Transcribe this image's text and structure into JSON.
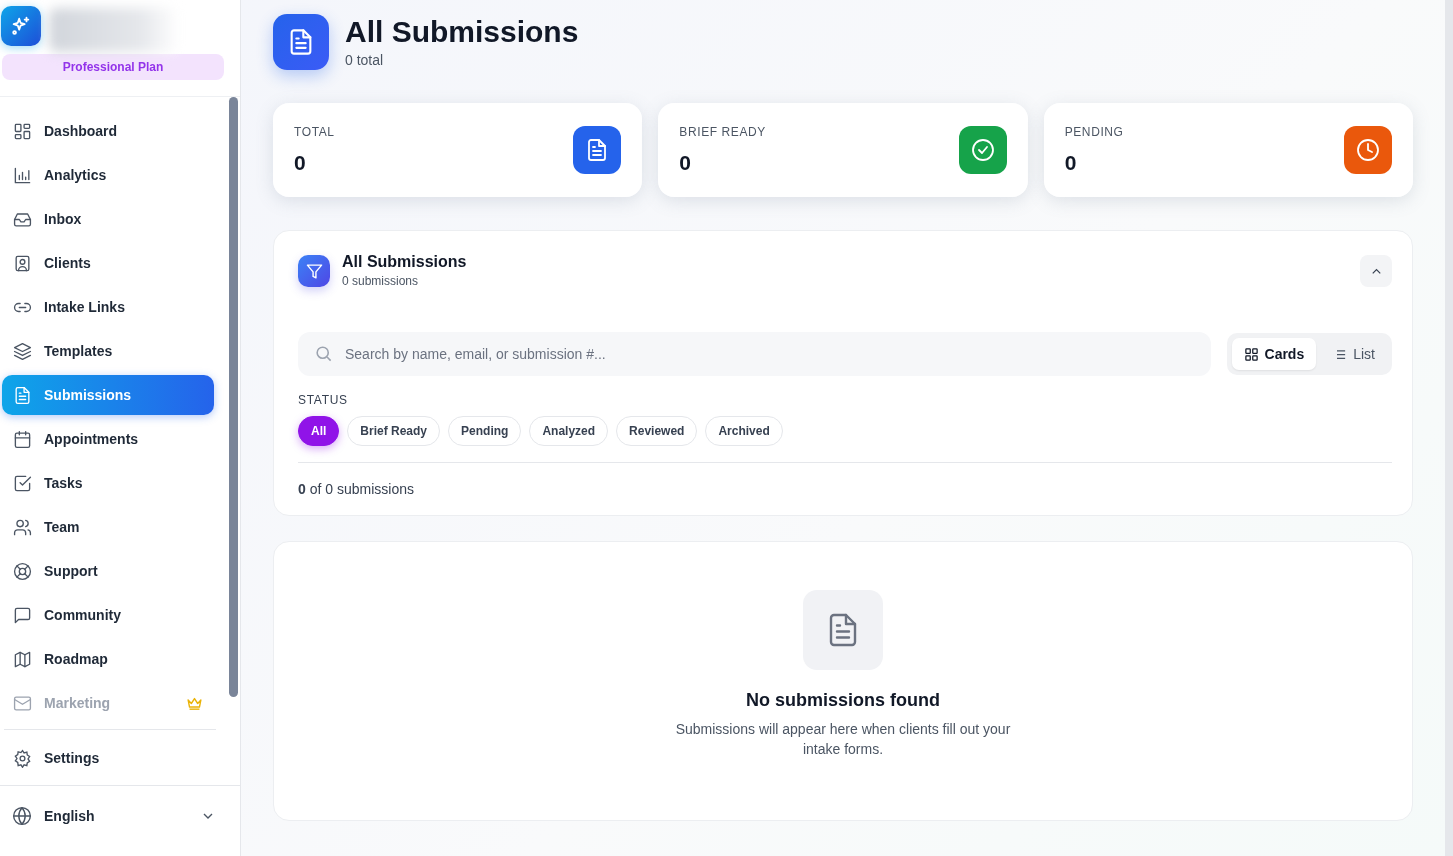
{
  "sidebar": {
    "plan": "Professional Plan",
    "items": [
      {
        "label": "Dashboard",
        "selected": false,
        "disabled": false,
        "premium": false
      },
      {
        "label": "Analytics",
        "selected": false,
        "disabled": false,
        "premium": false
      },
      {
        "label": "Inbox",
        "selected": false,
        "disabled": false,
        "premium": false
      },
      {
        "label": "Clients",
        "selected": false,
        "disabled": false,
        "premium": false
      },
      {
        "label": "Intake Links",
        "selected": false,
        "disabled": false,
        "premium": false
      },
      {
        "label": "Templates",
        "selected": false,
        "disabled": false,
        "premium": false
      },
      {
        "label": "Submissions",
        "selected": true,
        "disabled": false,
        "premium": false
      },
      {
        "label": "Appointments",
        "selected": false,
        "disabled": false,
        "premium": false
      },
      {
        "label": "Tasks",
        "selected": false,
        "disabled": false,
        "premium": false
      },
      {
        "label": "Team",
        "selected": false,
        "disabled": false,
        "premium": false
      },
      {
        "label": "Support",
        "selected": false,
        "disabled": false,
        "premium": false
      },
      {
        "label": "Community",
        "selected": false,
        "disabled": false,
        "premium": false
      },
      {
        "label": "Roadmap",
        "selected": false,
        "disabled": false,
        "premium": false
      },
      {
        "label": "Marketing",
        "selected": false,
        "disabled": true,
        "premium": true
      }
    ],
    "settings": "Settings",
    "language": "English"
  },
  "header": {
    "title": "All Submissions",
    "subtitle": "0 total"
  },
  "stats": [
    {
      "label": "TOTAL",
      "value": "0",
      "color": "#2563eb"
    },
    {
      "label": "BRIEF READY",
      "value": "0",
      "color": "#16a34a"
    },
    {
      "label": "PENDING",
      "value": "0",
      "color": "#ea580c"
    }
  ],
  "panel": {
    "title": "All Submissions",
    "subtitle": "0 submissions",
    "expanded": true,
    "search": {
      "placeholder": "Search by name, email, or submission #..."
    },
    "views": [
      {
        "label": "Cards",
        "selected": true
      },
      {
        "label": "List",
        "selected": false
      }
    ],
    "status_label": "STATUS",
    "filters": [
      {
        "label": "All",
        "selected": true
      },
      {
        "label": "Brief Ready",
        "selected": false
      },
      {
        "label": "Pending",
        "selected": false
      },
      {
        "label": "Analyzed",
        "selected": false
      },
      {
        "label": "Reviewed",
        "selected": false
      },
      {
        "label": "Archived",
        "selected": false
      }
    ],
    "count": "**0** of 0 submissions"
  },
  "empty": {
    "title": "No submissions found",
    "text": "Submissions will appear here when clients fill out your intake forms."
  }
}
